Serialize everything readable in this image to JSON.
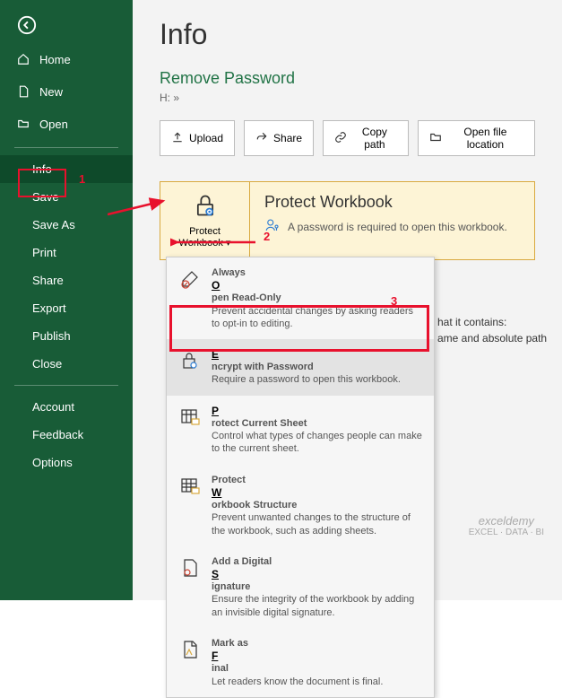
{
  "sidebar": {
    "items": [
      {
        "label": "Home"
      },
      {
        "label": "New"
      },
      {
        "label": "Open"
      },
      {
        "label": "Info"
      },
      {
        "label": "Save"
      },
      {
        "label": "Save As"
      },
      {
        "label": "Print"
      },
      {
        "label": "Share"
      },
      {
        "label": "Export"
      },
      {
        "label": "Publish"
      },
      {
        "label": "Close"
      },
      {
        "label": "Account"
      },
      {
        "label": "Feedback"
      },
      {
        "label": "Options"
      }
    ]
  },
  "page": {
    "title": "Info",
    "doc_title": "Remove Password",
    "path": "H: »"
  },
  "actions": {
    "upload": "Upload",
    "share": "Share",
    "copy_path": "Copy path",
    "open_location": "Open file location"
  },
  "protect": {
    "button_label": "Protect Workbook",
    "heading": "Protect Workbook",
    "desc": "A password is required to open this workbook."
  },
  "extra": {
    "line1": "hat it contains:",
    "line2": "ame and absolute path"
  },
  "dropdown": {
    "items": [
      {
        "title_pre": "Always ",
        "hot": "O",
        "title_post": "pen Read-Only",
        "desc": "Prevent accidental changes by asking readers to opt-in to editing."
      },
      {
        "title_pre": "",
        "hot": "E",
        "title_post": "ncrypt with Password",
        "desc": "Require a password to open this workbook."
      },
      {
        "title_pre": "",
        "hot": "P",
        "title_post": "rotect Current Sheet",
        "desc": "Control what types of changes people can make to the current sheet."
      },
      {
        "title_pre": "Protect ",
        "hot": "W",
        "title_post": "orkbook Structure",
        "desc": "Prevent unwanted changes to the structure of the workbook, such as adding sheets."
      },
      {
        "title_pre": "Add a Digital ",
        "hot": "S",
        "title_post": "ignature",
        "desc": "Ensure the integrity of the workbook by adding an invisible digital signature."
      },
      {
        "title_pre": "Mark as ",
        "hot": "F",
        "title_post": "inal",
        "desc": "Let readers know the document is final."
      }
    ]
  },
  "annotations": {
    "n1": "1",
    "n2": "2",
    "n3": "3"
  },
  "watermark": {
    "brand": "exceldemy",
    "tag": "EXCEL · DATA · BI"
  }
}
